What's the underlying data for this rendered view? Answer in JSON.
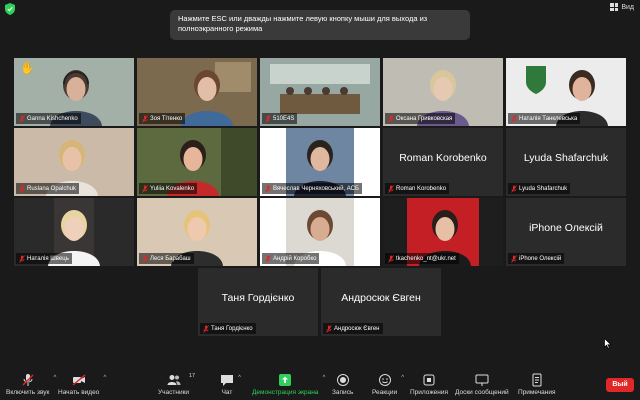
{
  "topbar": {
    "view_label": "Вид"
  },
  "banner": {
    "text": "Нажмите ESC или дважды нажмите левую кнопку мыши для выхода из полноэкранного режима"
  },
  "participants": [
    {
      "name": "Ganna Kishchenko",
      "bigname": "",
      "video": "person-headset",
      "bg": "#9aa7a0",
      "hand": true,
      "active": false
    },
    {
      "name": "Зоя Тітенко",
      "bigname": "",
      "video": "person-room",
      "bg": "#7b6a4e",
      "hand": false,
      "active": false
    },
    {
      "name": "510Е4S",
      "bigname": "",
      "video": "classroom",
      "bg": "#8c9c96",
      "hand": false,
      "active": true
    },
    {
      "name": "Оксана Гривковская",
      "bigname": "",
      "video": "person-light",
      "bg": "#b9b7b0",
      "hand": false,
      "active": false
    },
    {
      "name": "Наталія Танклевська",
      "bigname": "",
      "video": "person-emblem",
      "bg": "#e8e8e8",
      "hand": false,
      "active": false
    },
    {
      "name": "Ruslana Opalchuk",
      "bigname": "",
      "video": "person-blonde",
      "bg": "#c9b9a8",
      "hand": false,
      "active": false
    },
    {
      "name": "Yuliia Kovalenko",
      "bigname": "",
      "video": "person-red",
      "bg": "#5d6a3f",
      "hand": false,
      "active": false
    },
    {
      "name": "Вячеслав Черняховський, АСБ",
      "bigname": "",
      "video": "person-suit",
      "bg": "#6a7f9a",
      "hand": false,
      "active": false
    },
    {
      "name": "Roman Korobenko",
      "bigname": "Roman Korobenko",
      "video": "none",
      "bg": "#2b2b2b",
      "hand": false,
      "active": false
    },
    {
      "name": "Lyuda Shafarchuk",
      "bigname": "Lyuda Shafarchuk",
      "video": "none",
      "bg": "#2b2b2b",
      "hand": false,
      "active": false
    },
    {
      "name": "Наталія Швець",
      "bigname": "",
      "video": "person-dark",
      "bg": "#2a2a2a",
      "hand": false,
      "active": false
    },
    {
      "name": "Леся Барабаш",
      "bigname": "",
      "video": "person-blonde2",
      "bg": "#d7c7b2",
      "hand": false,
      "active": false
    },
    {
      "name": "Андрій Коробко",
      "bigname": "",
      "video": "person-man",
      "bg": "#d9d6d0",
      "hand": false,
      "active": false
    },
    {
      "name": "tkachenko_nt@ukr.net",
      "bigname": "",
      "video": "person-redwall",
      "bg": "#c51f26",
      "hand": false,
      "active": false
    },
    {
      "name": "iPhone Олексій",
      "bigname": "iPhone Олексій",
      "video": "none",
      "bg": "#2b2b2b",
      "hand": false,
      "active": false
    },
    {
      "name": "Таня Гордієнко",
      "bigname": "Таня Гордієнко",
      "video": "none",
      "bg": "#2b2b2b",
      "hand": false,
      "active": false
    },
    {
      "name": "Андросюк Євген",
      "bigname": "Андросюк Євген",
      "video": "none",
      "bg": "#2b2b2b",
      "hand": false,
      "active": false
    }
  ],
  "toolbar": {
    "unmute": "Включить звук",
    "start_video": "Начать видео",
    "participants": "Участники",
    "participants_count": "17",
    "chat": "Чат",
    "share": "Демонстрация экрана",
    "record": "Запись",
    "reactions": "Реакции",
    "apps": "Приложения",
    "whiteboards": "Доски сообщений",
    "notes": "Примечания",
    "exit": "Вый"
  },
  "colors": {
    "accent_green": "#2fd05a",
    "muted_red": "#e02828",
    "tile_bg": "#2b2b2b"
  }
}
